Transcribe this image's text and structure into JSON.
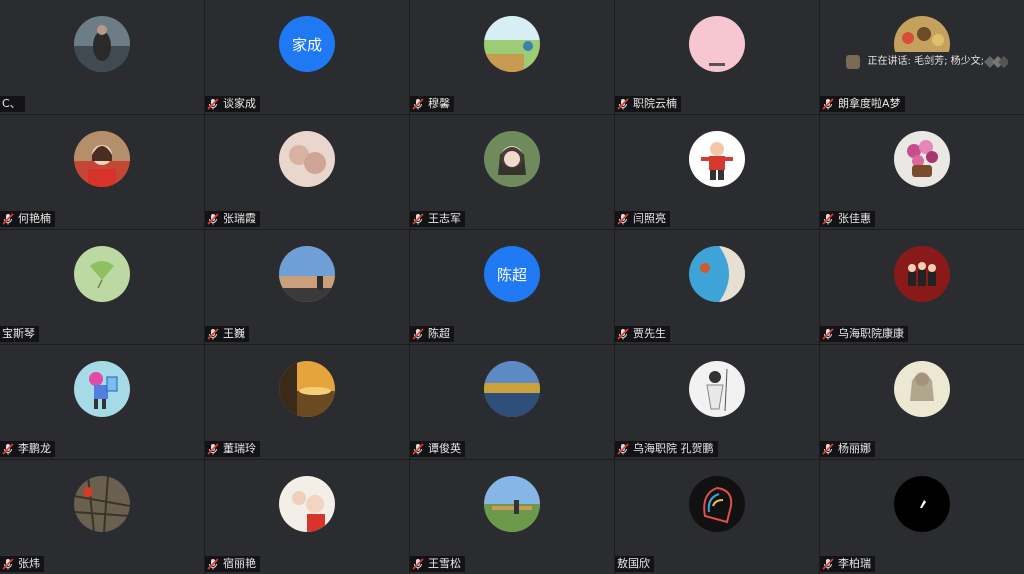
{
  "speaking": {
    "text": "正在讲话: 毛剑芳; 杨少文;"
  },
  "tiles": [
    {
      "name": "C、",
      "mic": false,
      "avatar": "photo"
    },
    {
      "name": "谈家成",
      "mic": true,
      "avatar": "text",
      "avatar_text": "家成"
    },
    {
      "name": "穆馨",
      "mic": true,
      "avatar": "photo"
    },
    {
      "name": "职院云楠",
      "mic": true,
      "avatar": "photo"
    },
    {
      "name": "朗拿度啦A梦",
      "mic": true,
      "avatar": "photo"
    },
    {
      "name": "何艳楠",
      "mic": true,
      "avatar": "photo"
    },
    {
      "name": "张瑞霞",
      "mic": true,
      "avatar": "photo"
    },
    {
      "name": "王志军",
      "mic": true,
      "avatar": "photo"
    },
    {
      "name": "闫照亮",
      "mic": true,
      "avatar": "photo"
    },
    {
      "name": "张佳惠",
      "mic": true,
      "avatar": "photo"
    },
    {
      "name": "宝斯琴",
      "mic": false,
      "avatar": "photo"
    },
    {
      "name": "王巍",
      "mic": true,
      "avatar": "photo"
    },
    {
      "name": "陈超",
      "mic": true,
      "avatar": "text",
      "avatar_text": "陈超"
    },
    {
      "name": "贾先生",
      "mic": true,
      "avatar": "photo"
    },
    {
      "name": "乌海职院康康",
      "mic": true,
      "avatar": "photo"
    },
    {
      "name": "李鹏龙",
      "mic": true,
      "avatar": "photo"
    },
    {
      "name": "董瑞玲",
      "mic": true,
      "avatar": "photo"
    },
    {
      "name": "谭俊英",
      "mic": true,
      "avatar": "photo"
    },
    {
      "name": "乌海职院 孔贺鹏",
      "mic": true,
      "avatar": "photo"
    },
    {
      "name": "杨丽娜",
      "mic": true,
      "avatar": "photo"
    },
    {
      "name": "张炜",
      "mic": true,
      "avatar": "photo"
    },
    {
      "name": "宿丽艳",
      "mic": true,
      "avatar": "photo"
    },
    {
      "name": "王雪松",
      "mic": true,
      "avatar": "photo"
    },
    {
      "name": "敖国欣",
      "mic": false,
      "avatar": "photo"
    },
    {
      "name": "李柏瑞",
      "mic": true,
      "avatar": "photo"
    }
  ]
}
